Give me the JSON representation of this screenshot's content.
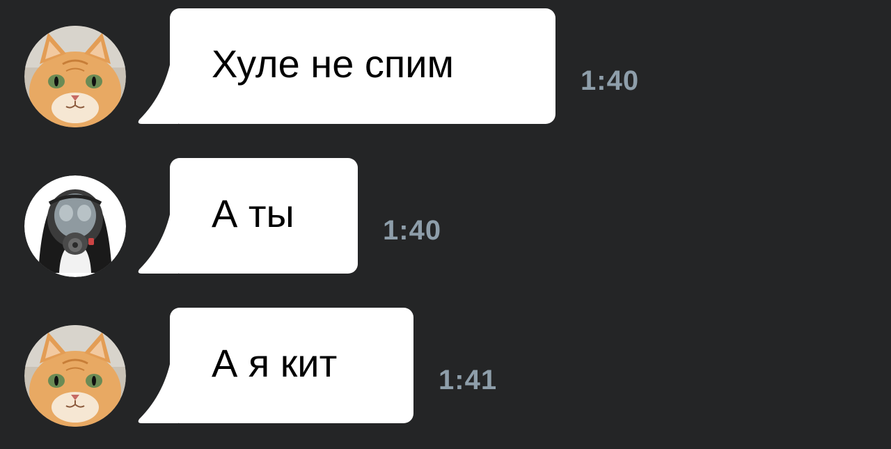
{
  "colors": {
    "background": "#242526",
    "bubble": "#ffffff",
    "bubble_text": "#000000",
    "timestamp": "#8e9eaa"
  },
  "messages": [
    {
      "avatar_icon": "cat-avatar-icon",
      "text": "Хуле не спим",
      "time": "1:40"
    },
    {
      "avatar_icon": "gas-mask-avatar-icon",
      "text": "А ты",
      "time": "1:40"
    },
    {
      "avatar_icon": "cat-avatar-icon",
      "text": "А я кит",
      "time": "1:41"
    }
  ]
}
